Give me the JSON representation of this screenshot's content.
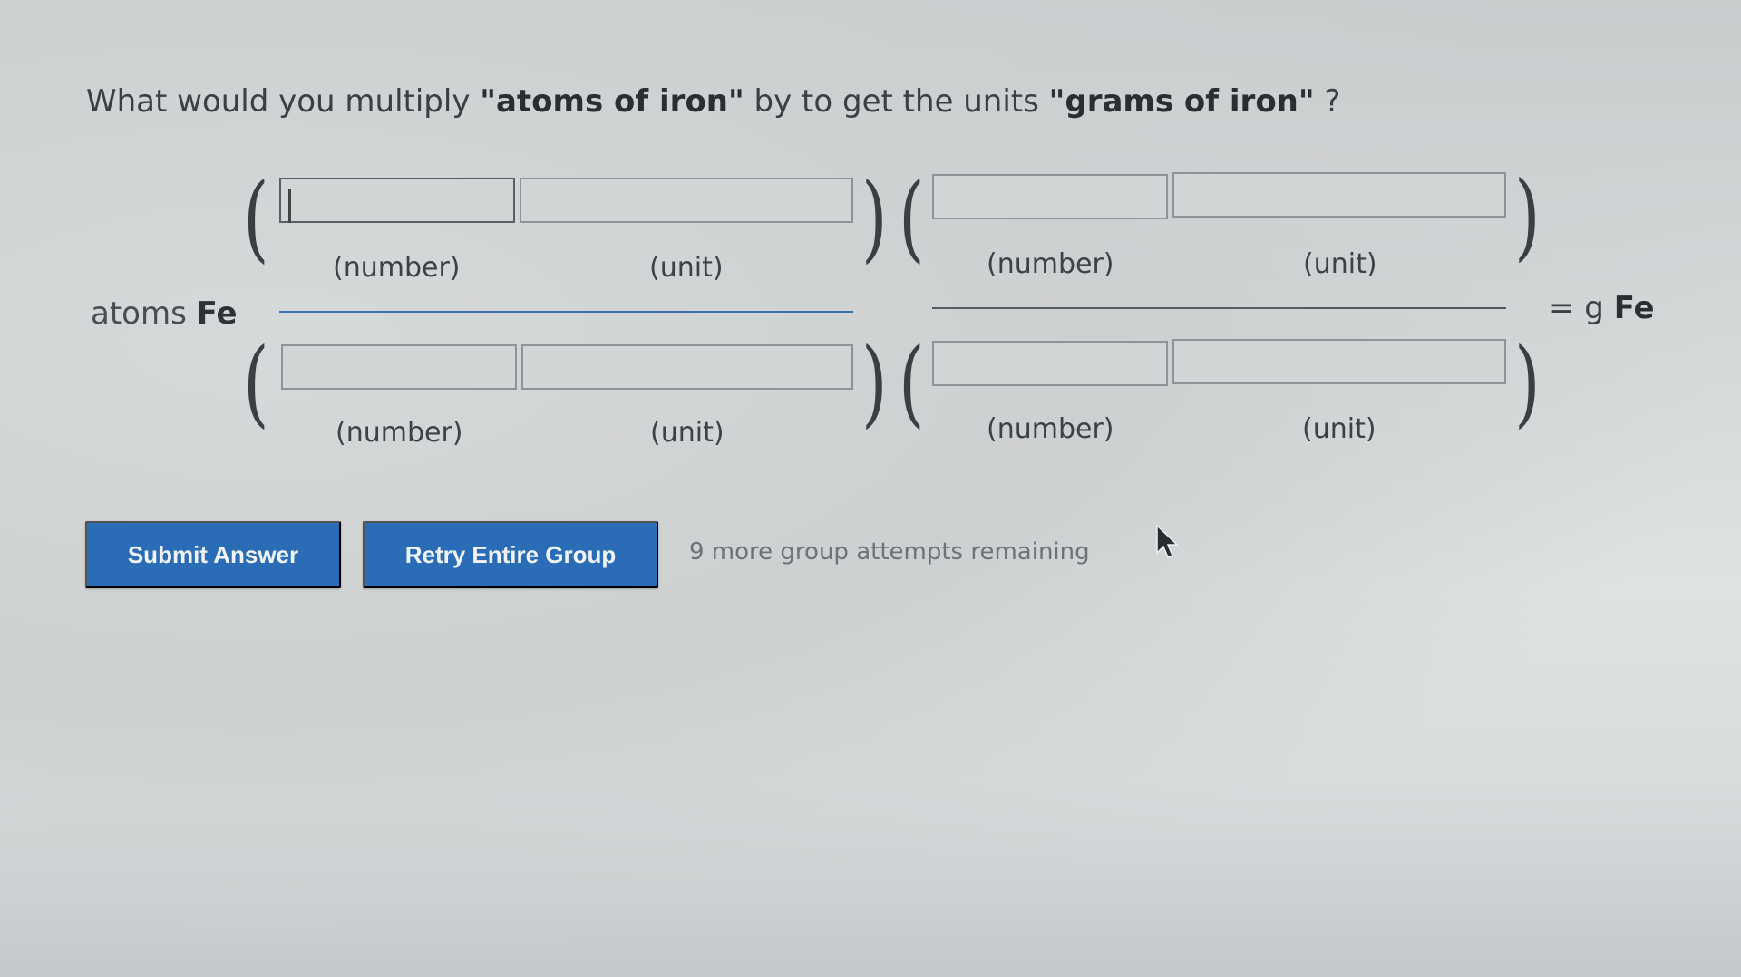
{
  "question": {
    "prefix": "What would you multiply ",
    "from_units": "\"atoms of iron\"",
    "middle": " by to get the units ",
    "to_units": "\"grams of iron\"",
    "suffix": " ?"
  },
  "equation": {
    "start_quantity": "atoms",
    "start_element": "Fe",
    "result_prefix": "= g",
    "result_element": "Fe",
    "number_label": "(number)",
    "unit_label": "(unit)",
    "fields": {
      "f1_num_number": "",
      "f1_num_unit": "",
      "f1_den_number": "",
      "f1_den_unit": "",
      "f2_num_number": "",
      "f2_num_unit": "",
      "f2_den_number": "",
      "f2_den_unit": ""
    }
  },
  "actions": {
    "submit_label": "Submit Answer",
    "retry_label": "Retry Entire Group",
    "attempts_text": "9 more group attempts remaining"
  },
  "colors": {
    "button_blue": "#2a6cb5",
    "fraction_line_first": "#3a6fb0",
    "fraction_line_second": "#555a5e"
  },
  "icons": [
    "mouse-pointer-icon"
  ]
}
